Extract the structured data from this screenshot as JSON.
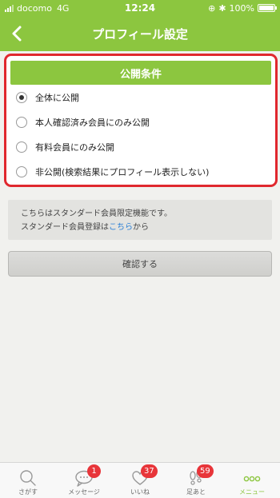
{
  "status": {
    "carrier": "docomo",
    "network": "4G",
    "time": "12:24",
    "battery": "100%"
  },
  "nav": {
    "title": "プロフィール設定"
  },
  "conditions": {
    "header": "公開条件",
    "options": [
      {
        "label": "全体に公開",
        "checked": true
      },
      {
        "label": "本人確認済み会員にのみ公開",
        "checked": false
      },
      {
        "label": "有料会員にのみ公開",
        "checked": false
      },
      {
        "label": "非公開(検索結果にプロフィール表示しない)",
        "checked": false
      }
    ]
  },
  "notice": {
    "line1": "こちらはスタンダード会員限定機能です。",
    "line2_prefix": "スタンダード会員登録は",
    "line2_link": "こちら",
    "line2_suffix": "から"
  },
  "confirm_label": "確認する",
  "tabs": [
    {
      "label": "さがす",
      "icon": "search-icon",
      "badge": null
    },
    {
      "label": "メッセージ",
      "icon": "message-icon",
      "badge": "1"
    },
    {
      "label": "いいね",
      "icon": "heart-icon",
      "badge": "37"
    },
    {
      "label": "足あと",
      "icon": "footprint-icon",
      "badge": "59"
    },
    {
      "label": "メニュー",
      "icon": "menu-dots-icon",
      "badge": null
    }
  ],
  "colors": {
    "brand_green": "#8cc63f",
    "highlight_red": "#e0282e",
    "badge_red": "#e8353a",
    "link_blue": "#2a7fd6"
  }
}
